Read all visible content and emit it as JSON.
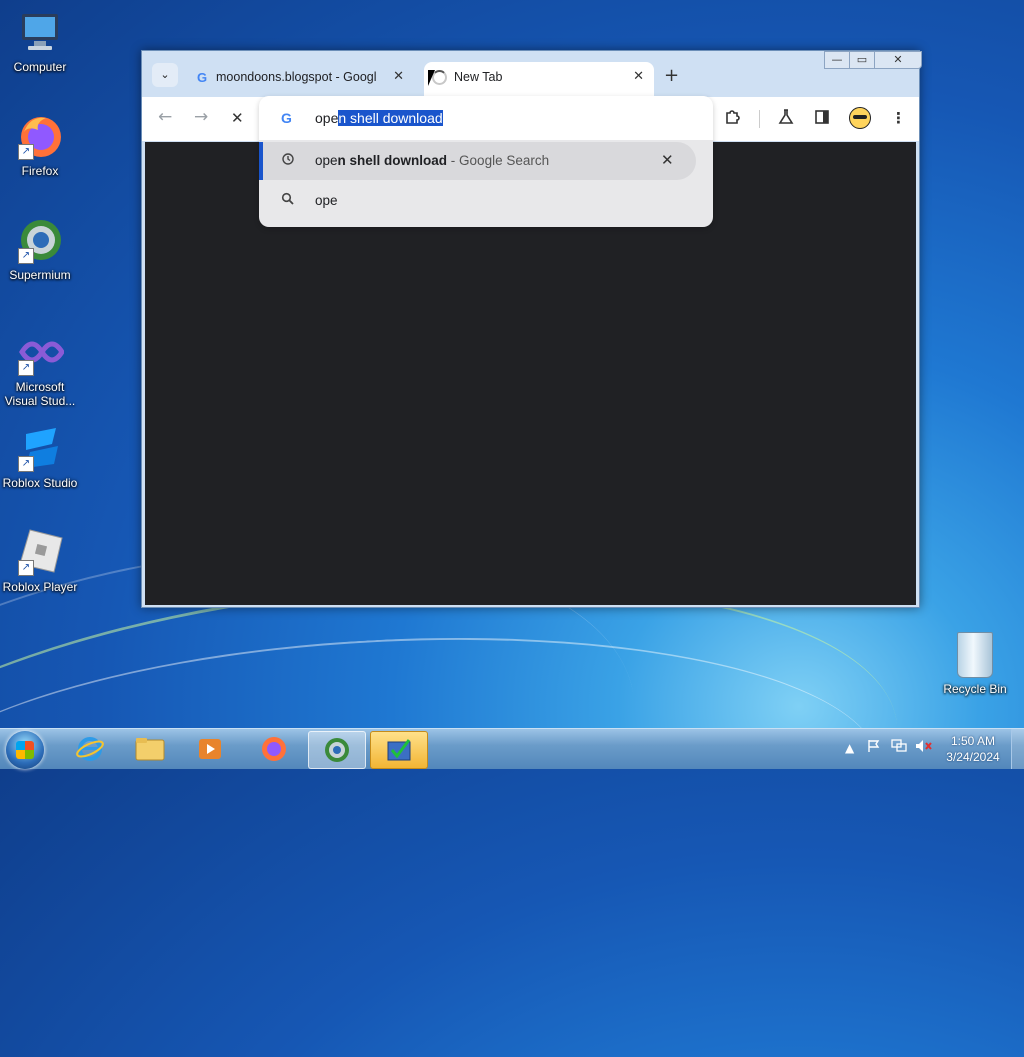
{
  "desktop": {
    "icons": [
      {
        "label": "Computer"
      },
      {
        "label": "Firefox"
      },
      {
        "label": "Supermium"
      },
      {
        "label": "Microsoft Visual Stud..."
      },
      {
        "label": "Roblox Studio"
      },
      {
        "label": "Roblox Player"
      }
    ],
    "recycle_bin": "Recycle Bin"
  },
  "browser": {
    "tabs": [
      {
        "title": "moondoons.blogspot - Google",
        "favicon": "G",
        "close": "✕"
      },
      {
        "title": "New Tab",
        "close": "✕"
      }
    ],
    "new_tab": "+",
    "tab_search": "⌄",
    "window_controls": {
      "minimize": "—",
      "maximize": "▭",
      "close": "✕"
    },
    "toolbar": {
      "back": "←",
      "forward": "→",
      "stop": "✕"
    },
    "omnibox": {
      "google_icon": "G",
      "typed": "ope",
      "autocomplete": "n shell download",
      "suggestions": [
        {
          "typed": "ope",
          "completion": "n shell download",
          "separator": " - ",
          "source": "Google Search",
          "icon": "history-icon",
          "remove": "✕"
        },
        {
          "text": "ope",
          "icon": "search-icon"
        }
      ]
    }
  },
  "taskbar": {
    "clock_time": "1:50 AM",
    "clock_date": "3/24/2024"
  }
}
